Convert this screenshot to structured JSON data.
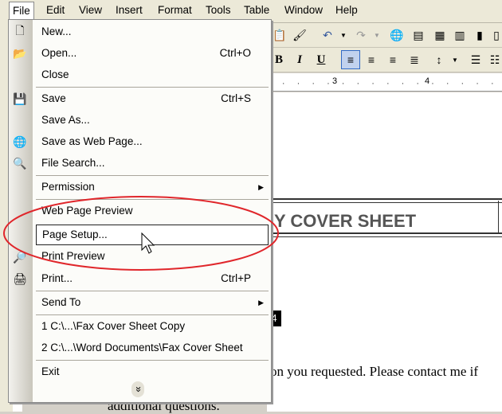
{
  "menubar": {
    "items": [
      "File",
      "Edit",
      "View",
      "Insert",
      "Format",
      "Tools",
      "Table",
      "Window",
      "Help"
    ]
  },
  "format_toolbar": {
    "bold": "B",
    "italic": "I",
    "underline": "U"
  },
  "ruler": {
    "marks": [
      "3",
      "4"
    ]
  },
  "document": {
    "title_fragment": "Y COVER SHEET",
    "highlight_fragment": "4",
    "line1": "on you requested. Please contact me if",
    "line2": "additional questions."
  },
  "file_menu": {
    "items": [
      {
        "label": "New...",
        "shortcut": ""
      },
      {
        "label": "Open...",
        "shortcut": "Ctrl+O"
      },
      {
        "label": "Close",
        "shortcut": ""
      },
      {
        "label": "Save",
        "shortcut": "Ctrl+S"
      },
      {
        "label": "Save As...",
        "shortcut": ""
      },
      {
        "label": "Save as Web Page...",
        "shortcut": ""
      },
      {
        "label": "File Search...",
        "shortcut": ""
      },
      {
        "label": "Permission",
        "shortcut": ""
      },
      {
        "label": "Web Page Preview",
        "shortcut": ""
      },
      {
        "label": "Page Setup...",
        "shortcut": ""
      },
      {
        "label": "Print Preview",
        "shortcut": ""
      },
      {
        "label": "Print...",
        "shortcut": "Ctrl+P"
      },
      {
        "label": "Send To",
        "shortcut": ""
      },
      {
        "label": "1 C:\\...\\Fax Cover Sheet Copy",
        "shortcut": ""
      },
      {
        "label": "2 C:\\...\\Word Documents\\Fax Cover Sheet",
        "shortcut": ""
      },
      {
        "label": "Exit",
        "shortcut": ""
      }
    ],
    "expand_symbol": "»"
  },
  "colors": {
    "annotation_ellipse": "#e0262b",
    "menu_highlight_border": "#222222"
  }
}
